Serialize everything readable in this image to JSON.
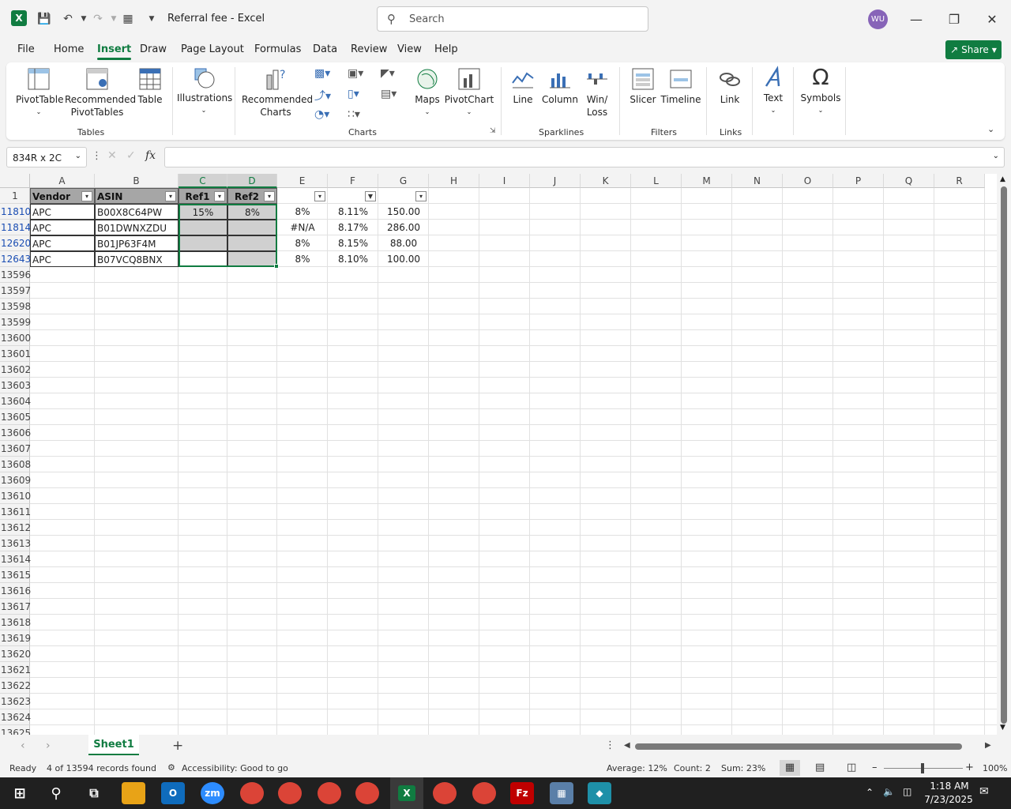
{
  "window": {
    "title": "Referral fee  -  Excel",
    "search_placeholder": "Search",
    "user_initials": "WU"
  },
  "menu": {
    "tabs": [
      "File",
      "Home",
      "Insert",
      "Draw",
      "Page Layout",
      "Formulas",
      "Data",
      "Review",
      "View",
      "Help"
    ],
    "active": "Insert",
    "share": "Share"
  },
  "ribbon": {
    "items": {
      "pivottable": "PivotTable",
      "rec_pivot1": "Recommended",
      "rec_pivot2": "PivotTables",
      "table": "Table",
      "illustrations": "Illustrations",
      "rec_charts1": "Recommended",
      "rec_charts2": "Charts",
      "maps": "Maps",
      "pivotchart": "PivotChart",
      "line": "Line",
      "column": "Column",
      "winloss1": "Win/",
      "winloss2": "Loss",
      "slicer": "Slicer",
      "timeline": "Timeline",
      "link": "Link",
      "text": "Text",
      "symbols": "Symbols"
    },
    "groups": {
      "tables": "Tables",
      "charts": "Charts",
      "sparklines": "Sparklines",
      "filters": "Filters",
      "links": "Links"
    }
  },
  "formula": {
    "namebox": "834R x 2C",
    "fx": "fx"
  },
  "columns": [
    "A",
    "B",
    "C",
    "D",
    "E",
    "F",
    "G",
    "H",
    "I",
    "J",
    "K",
    "L",
    "M",
    "N",
    "O",
    "P",
    "Q",
    "R"
  ],
  "header_row": {
    "num": "1",
    "A": "Vendor",
    "B": "ASIN",
    "C": "Ref1",
    "D": "Ref2"
  },
  "rows": [
    {
      "num": "11810",
      "A": "APC",
      "B": "B00X8C64PW",
      "C": "15%",
      "D": "8%",
      "E": "8%",
      "F": "8.11%",
      "G": "150.00"
    },
    {
      "num": "11814",
      "A": "APC",
      "B": "B01DWNXZDU",
      "C": "",
      "D": "",
      "E": "#N/A",
      "F": "8.17%",
      "G": "286.00"
    },
    {
      "num": "12620",
      "A": "APC",
      "B": "B01JP63F4M",
      "C": "",
      "D": "",
      "E": "8%",
      "F": "8.15%",
      "G": "88.00"
    },
    {
      "num": "12643",
      "A": "APC",
      "B": "B07VCQ8BNX",
      "C": "",
      "D": "",
      "E": "8%",
      "F": "8.10%",
      "G": "100.00"
    }
  ],
  "empty_rows": [
    "13596",
    "13597",
    "13598",
    "13599",
    "13600",
    "13601",
    "13602",
    "13603",
    "13604",
    "13605",
    "13606",
    "13607",
    "13608",
    "13609",
    "13610",
    "13611",
    "13612",
    "13613",
    "13614",
    "13615",
    "13616",
    "13617",
    "13618",
    "13619",
    "13620",
    "13621",
    "13622",
    "13623",
    "13624",
    "13625"
  ],
  "sheet": {
    "name": "Sheet1"
  },
  "status": {
    "ready": "Ready",
    "records": "4 of 13594 records found",
    "accessibility": "Accessibility: Good to go",
    "average": "Average: 12%",
    "count": "Count: 2",
    "sum": "Sum: 23%",
    "zoom": "100%"
  },
  "clock": {
    "time": "1:18 AM",
    "date": "7/23/2025"
  },
  "colors": {
    "accent": "#107c41",
    "header_fill": "#a6a6a6",
    "selection_fill": "#d0d0d0"
  }
}
